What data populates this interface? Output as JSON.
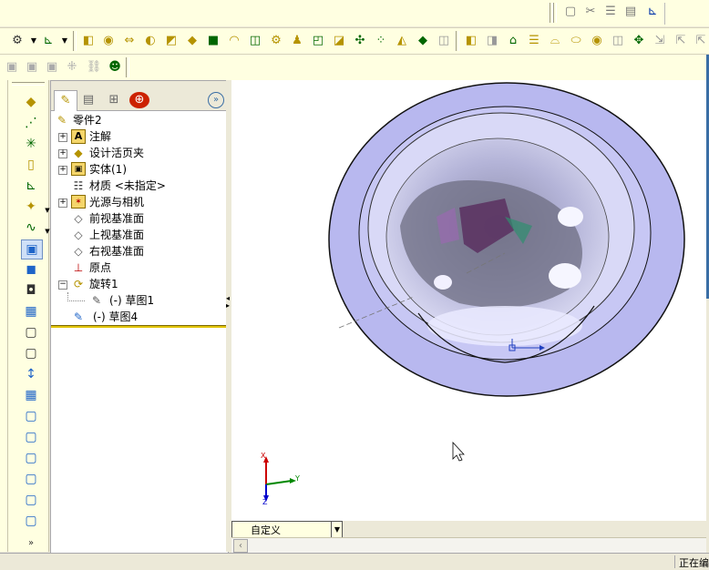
{
  "tree": {
    "root_label": "零件2",
    "items": [
      {
        "label": "注解",
        "icon": "annotation-icon",
        "expandable": true
      },
      {
        "label": "设计活页夹",
        "icon": "design-binder-icon",
        "expandable": true
      },
      {
        "label": "实体(1)",
        "icon": "solid-bodies-icon",
        "expandable": true
      },
      {
        "label": "材质 <未指定>",
        "icon": "material-icon",
        "expandable": false
      },
      {
        "label": "光源与相机",
        "icon": "lights-cameras-icon",
        "expandable": true
      },
      {
        "label": "前视基准面",
        "icon": "plane-icon",
        "expandable": false
      },
      {
        "label": "上视基准面",
        "icon": "plane-icon",
        "expandable": false
      },
      {
        "label": "右视基准面",
        "icon": "plane-icon",
        "expandable": false
      },
      {
        "label": "原点",
        "icon": "origin-icon",
        "expandable": false
      },
      {
        "label": "旋转1",
        "icon": "revolve-icon",
        "expandable": true,
        "expanded": true
      },
      {
        "label": "(-) 草图1",
        "icon": "sketch-icon",
        "child": true
      },
      {
        "label": "(-) 草图4",
        "icon": "sketch-icon",
        "expandable": false
      }
    ]
  },
  "panel_tabs": [
    "feature-manager-tab",
    "property-manager-tab",
    "configuration-manager-tab",
    "dimxpert-tab"
  ],
  "triad": {
    "x": "X",
    "y": "Y",
    "z": "Z"
  },
  "view_select": {
    "value": "自定义"
  },
  "status": {
    "text": "正在编"
  },
  "colors": {
    "accent": "#ffffe1",
    "part": "#b9b9f0"
  }
}
